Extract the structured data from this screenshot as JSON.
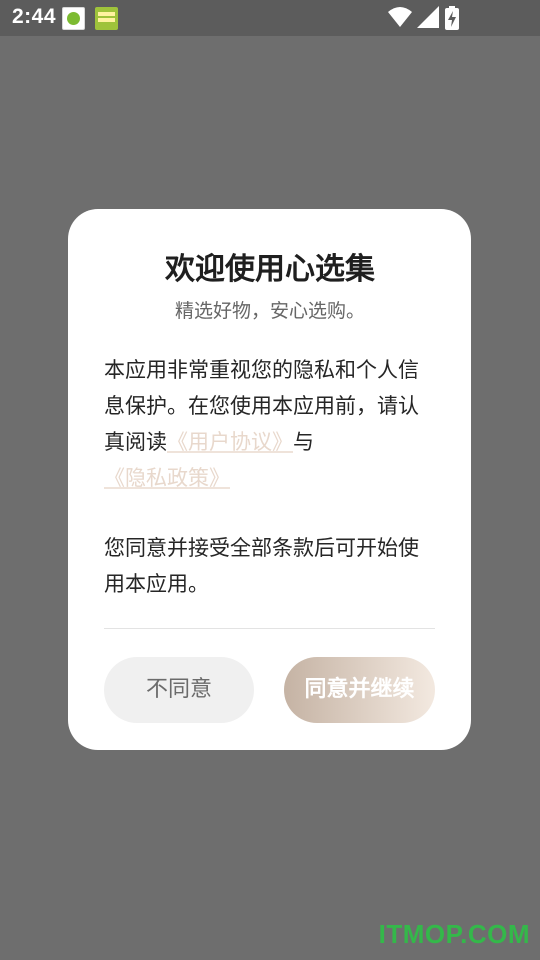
{
  "status_bar": {
    "time": "2:44"
  },
  "dialog": {
    "title": "欢迎使用心选集",
    "subtitle": "精选好物，安心选购。",
    "body_prefix": "本应用非常重视您的隐私和个人信息保护。在您使用本应用前，请认真阅读",
    "user_agreement_link": "《用户协议》",
    "conjunction": "与",
    "privacy_policy_link": "《隐私政策》",
    "body_second": "您同意并接受全部条款后可开始使用本应用。",
    "disagree_label": "不同意",
    "agree_label": "同意并继续"
  },
  "watermark": "ITMOP.COM",
  "colors": {
    "overlay": "#6e6e6e",
    "link": "#e8d8cc",
    "agree_gradient_start": "#c5b3a4",
    "agree_gradient_end": "#f3e9e0",
    "watermark": "#34b84a"
  },
  "icons": [
    "app-notification-icon",
    "app-notification-icon",
    "wifi-icon",
    "cellular-signal-icon",
    "battery-charging-icon"
  ]
}
